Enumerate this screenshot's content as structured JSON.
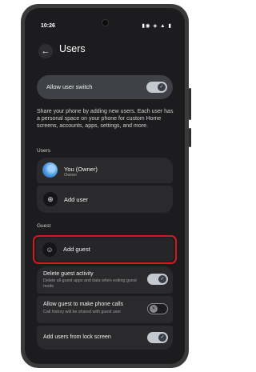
{
  "status_bar": {
    "time": "10:26",
    "left_icons": "▣ ◆ ⊕ •",
    "right_icons": "▮◉ ◈ ▲ ▮"
  },
  "header": {
    "back_icon": "arrow-left-icon",
    "title": "Users"
  },
  "allow_user_switch": {
    "label": "Allow user switch",
    "enabled": true
  },
  "description": "Share your phone by adding new users. Each user has a personal space on your phone for custom Home screens, accounts, apps, settings, and more.",
  "users_section": {
    "header": "Users",
    "current_user": {
      "name": "You (Owner)",
      "role": "Owner"
    },
    "add_user_label": "Add user"
  },
  "guest_section": {
    "header": "Guest",
    "add_guest_label": "Add guest",
    "delete_activity": {
      "title": "Delete guest activity",
      "subtitle": "Delete all guest apps and data when exiting guest mode",
      "enabled": true
    },
    "allow_calls": {
      "title": "Allow guest to make phone calls",
      "subtitle": "Call history will be shared with guest user",
      "enabled": false
    }
  },
  "lock_screen": {
    "title": "Add users from lock screen",
    "enabled": true
  },
  "colors": {
    "highlight": "#d01a1f",
    "background": "#1c1c1e",
    "card": "#2a2a2c",
    "toggle_on": "#c4c8cf"
  }
}
